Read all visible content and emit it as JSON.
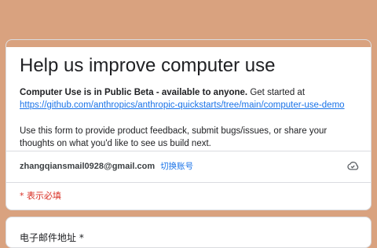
{
  "form": {
    "title": "Help us improve computer use",
    "desc_bold": "Computer Use is in Public Beta - available to anyone.",
    "desc_text1": " Get started at ",
    "desc_link": "https://github.com/anthropics/anthropic-quickstarts/tree/main/computer-use-demo",
    "desc_para2": "Use this form to provide product feedback, submit bugs/issues, or share your thoughts on what you'd like to see us build next.",
    "account_email": "zhangqiansmail0928@gmail.com",
    "switch_account": "切换账号",
    "required_note": "* 表示必填",
    "cloud_icon": "cloud-saved-icon"
  },
  "question": {
    "label": "电子邮件地址 *"
  },
  "colors": {
    "theme": "#d9a27f",
    "link": "#1a73e8",
    "required": "#d93025"
  }
}
